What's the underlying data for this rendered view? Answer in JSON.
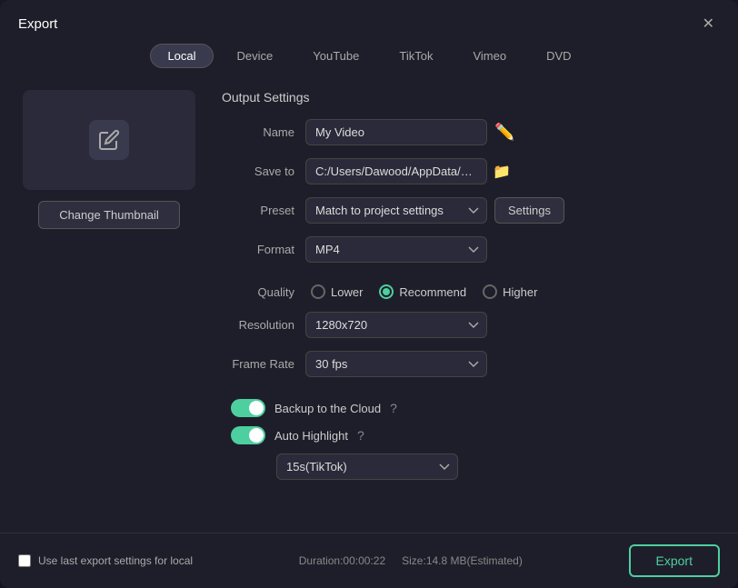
{
  "dialog": {
    "title": "Export",
    "close_label": "✕"
  },
  "tabs": {
    "items": [
      {
        "id": "local",
        "label": "Local",
        "active": true
      },
      {
        "id": "device",
        "label": "Device",
        "active": false
      },
      {
        "id": "youtube",
        "label": "YouTube",
        "active": false
      },
      {
        "id": "tiktok",
        "label": "TikTok",
        "active": false
      },
      {
        "id": "vimeo",
        "label": "Vimeo",
        "active": false
      },
      {
        "id": "dvd",
        "label": "DVD",
        "active": false
      }
    ]
  },
  "thumbnail": {
    "change_label": "Change Thumbnail"
  },
  "output_settings": {
    "title": "Output Settings",
    "name_label": "Name",
    "name_value": "My Video",
    "save_to_label": "Save to",
    "save_to_value": "C:/Users/Dawood/AppData/R...",
    "preset_label": "Preset",
    "preset_value": "Match to project settings",
    "settings_label": "Settings",
    "format_label": "Format",
    "format_value": "MP4",
    "quality_label": "Quality",
    "quality_options": [
      {
        "id": "lower",
        "label": "Lower",
        "checked": false
      },
      {
        "id": "recommend",
        "label": "Recommend",
        "checked": true
      },
      {
        "id": "higher",
        "label": "Higher",
        "checked": false
      }
    ],
    "resolution_label": "Resolution",
    "resolution_value": "1280x720",
    "framerate_label": "Frame Rate",
    "framerate_value": "30 fps",
    "backup_label": "Backup to the Cloud",
    "backup_on": true,
    "autohighlight_label": "Auto Highlight",
    "autohighlight_on": true,
    "tiktok_value": "15s(TikTok)"
  },
  "bottom": {
    "checkbox_label": "Use last export settings for local",
    "duration_label": "Duration:00:00:22",
    "size_label": "Size:14.8 MB(Estimated)",
    "export_label": "Export"
  }
}
